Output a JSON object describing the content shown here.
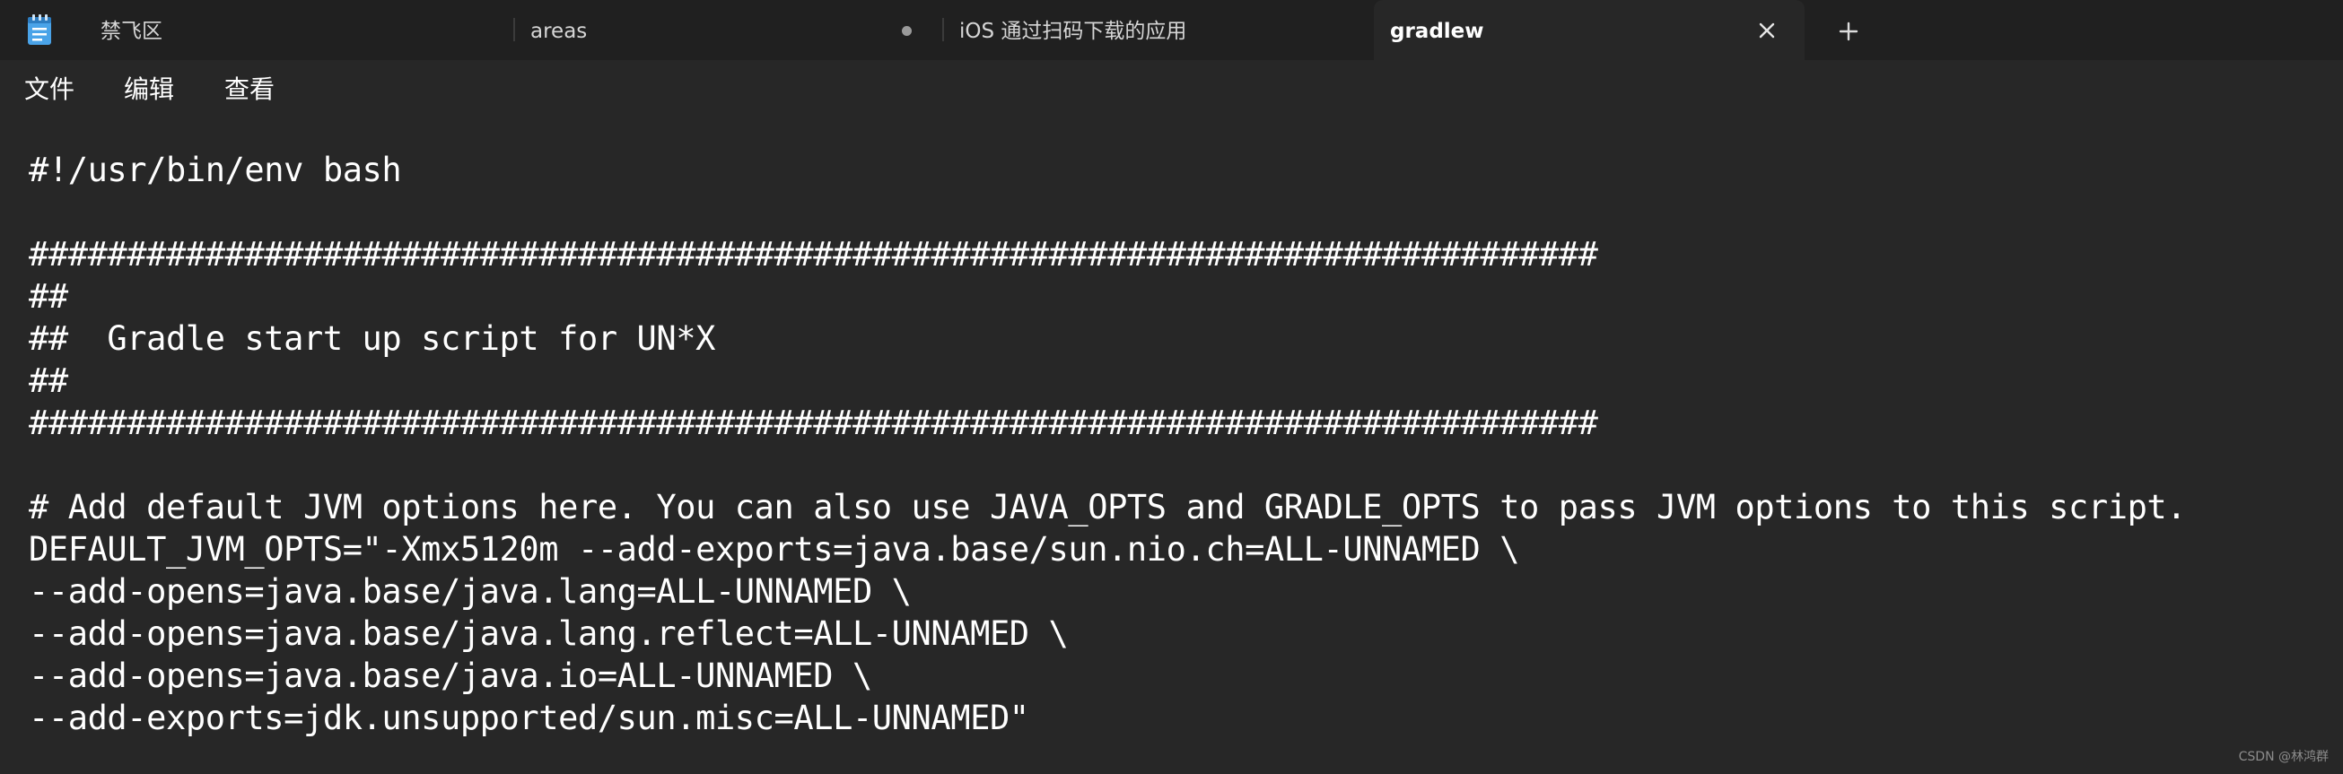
{
  "tabs": [
    {
      "label": "禁飞区"
    },
    {
      "label": "areas",
      "modified": true
    },
    {
      "label": "iOS  通过扫码下载的应用"
    },
    {
      "label": "gradlew",
      "active": true
    }
  ],
  "menu": [
    "文件",
    "编辑",
    "查看"
  ],
  "editor": {
    "lines": [
      "#!/usr/bin/env bash",
      "",
      "################################################################################",
      "##",
      "##  Gradle start up script for UN*X",
      "##",
      "################################################################################",
      "",
      "# Add default JVM options here. You can also use JAVA_OPTS and GRADLE_OPTS to pass JVM options to this script.",
      "DEFAULT_JVM_OPTS=\"-Xmx5120m --add-exports=java.base/sun.nio.ch=ALL-UNNAMED \\",
      "--add-opens=java.base/java.lang=ALL-UNNAMED \\",
      "--add-opens=java.base/java.lang.reflect=ALL-UNNAMED \\",
      "--add-opens=java.base/java.io=ALL-UNNAMED \\",
      "--add-exports=jdk.unsupported/sun.misc=ALL-UNNAMED\""
    ]
  },
  "watermark": "CSDN @林鸿群",
  "colors": {
    "tabstrip_bg": "#202020",
    "editor_bg": "#272727",
    "text": "#ffffff",
    "app_icon_accent": "#4aa3e8"
  },
  "icons": {
    "app": "notepad-icon",
    "close": "close-icon",
    "new_tab": "plus-icon",
    "modified": "unsaved-dot-icon"
  }
}
